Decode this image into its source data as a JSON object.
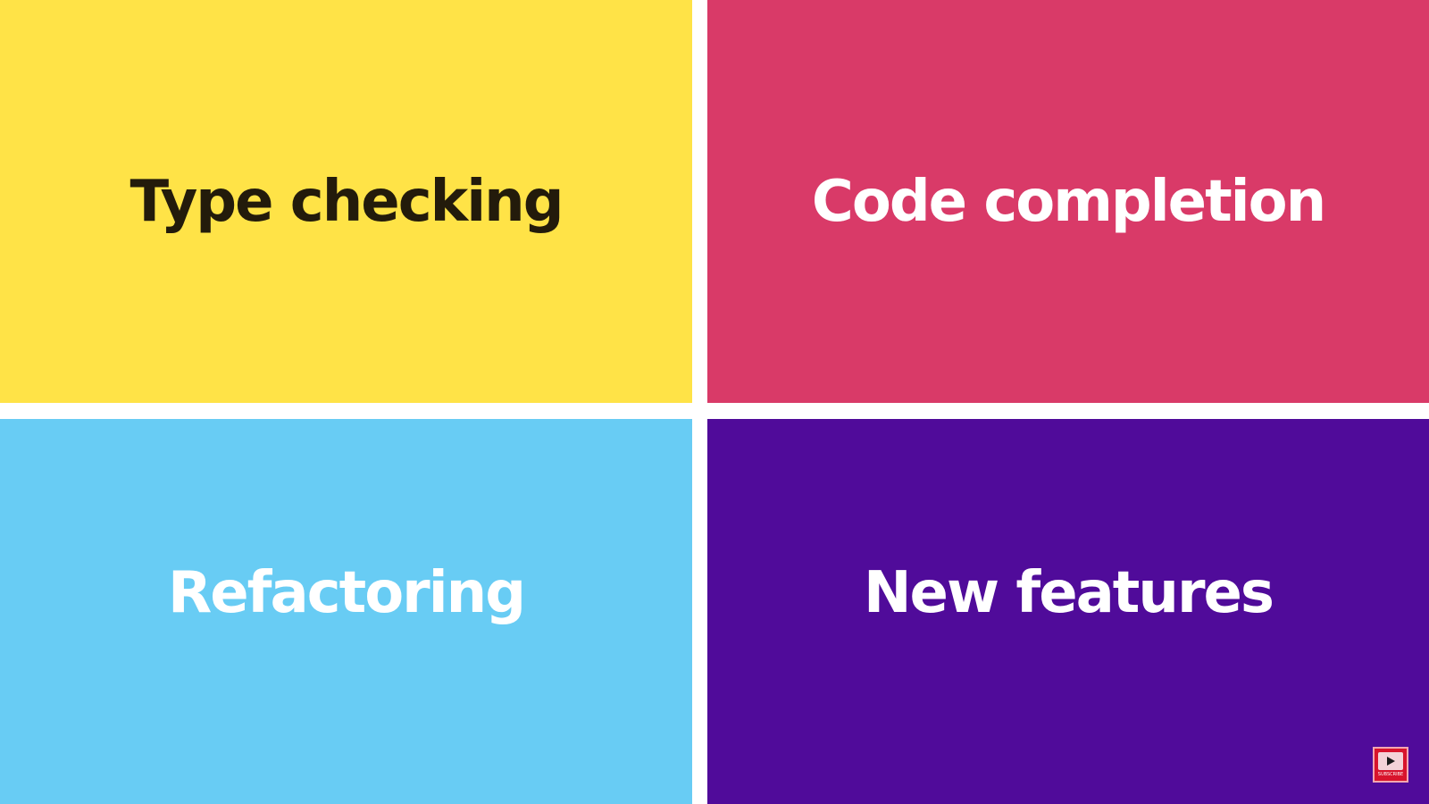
{
  "tiles": [
    {
      "label": "Type checking",
      "background": "#FFE347",
      "text_color": "#231B0B"
    },
    {
      "label": "Code completion",
      "background": "#D93A68",
      "text_color": "#FFFFFF"
    },
    {
      "label": "Refactoring",
      "background": "#68CCF4",
      "text_color": "#FFFFFF"
    },
    {
      "label": "New features",
      "background": "#500B9A",
      "text_color": "#FFFFFF"
    }
  ],
  "subscribe": {
    "label": "SUBSCRIBE",
    "icon": "play-icon",
    "background": "#D8142C"
  }
}
